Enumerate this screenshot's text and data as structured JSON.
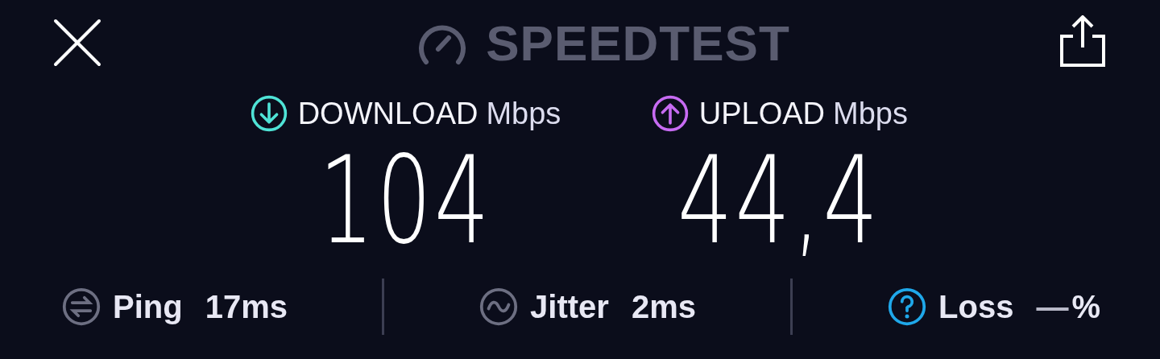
{
  "header": {
    "title": "SPEEDTEST"
  },
  "results": [
    {
      "kind": "download",
      "label": "DOWNLOAD",
      "unit": "Mbps",
      "value": "104",
      "color": "#4fe3d6"
    },
    {
      "kind": "upload",
      "label": "UPLOAD",
      "unit": "Mbps",
      "value": "44,4",
      "color": "#c76bf2"
    }
  ],
  "metrics": [
    {
      "kind": "ping",
      "label": "Ping",
      "value": "17ms"
    },
    {
      "kind": "jitter",
      "label": "Jitter",
      "value": "2ms"
    },
    {
      "kind": "loss",
      "label": "Loss",
      "value": "—",
      "unit": "%"
    }
  ]
}
